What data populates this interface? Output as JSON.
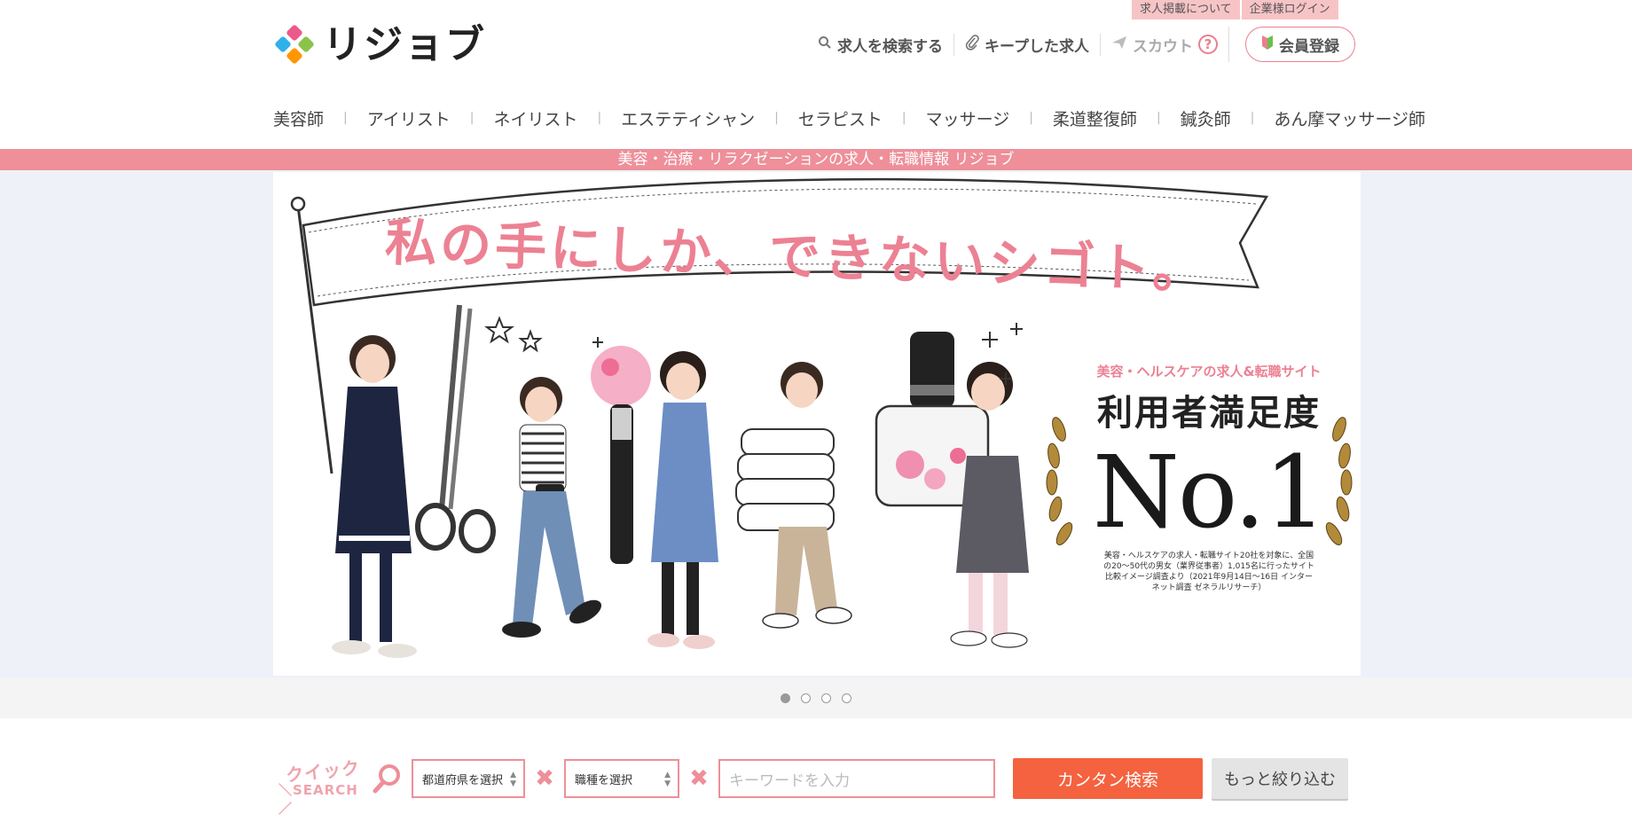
{
  "top_links": [
    "求人掲載について",
    "企業様ログイン"
  ],
  "logo": {
    "text": "リジョブ"
  },
  "utility": {
    "search": "求人を検索する",
    "kept": "キープした求人",
    "scout": "スカウト",
    "help": "?",
    "register": "会員登録"
  },
  "categories": [
    "美容師",
    "アイリスト",
    "ネイリスト",
    "エステティシャン",
    "セラピスト",
    "マッサージ",
    "柔道整復師",
    "鍼灸師",
    "あん摩マッサージ師"
  ],
  "category_separator": "|",
  "tagline": "美容・治療・リラクゼーションの求人・転職情報 リジョブ",
  "hero": {
    "headline": "私の手にしか、できないシゴト。",
    "badge_sub": "美容・ヘルスケアの求人&転職サイト",
    "badge_title": "利用者満足度",
    "badge_no1": "No.1",
    "badge_note": "美容・ヘルスケアの求人・転職サイト20社を対象に、全国の20〜50代の男女（業界従事者）1,015名に行ったサイト比較イメージ調査より（2021年9月14日〜16日 インターネット調査 ゼネラルリサーチ）"
  },
  "slider": {
    "count": 4,
    "active": 0
  },
  "quick_search": {
    "label_top": "クイック",
    "label_bottom": "＼SEARCH／",
    "prefecture": "都道府県を選択",
    "job": "職種を選択",
    "cross": "✖",
    "keyword_placeholder": "キーワードを入力",
    "search_button": "カンタン検索",
    "more_button": "もっと絞り込む"
  },
  "colors": {
    "pink": "#ee8f99",
    "orange": "#f4623f",
    "band": "#ee8f99"
  }
}
